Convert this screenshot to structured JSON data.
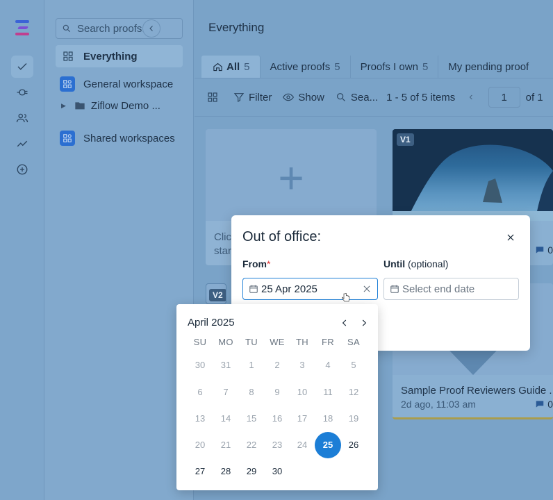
{
  "sidebar": {
    "search_placeholder": "Search proofs...",
    "items": [
      {
        "label": "Everything"
      },
      {
        "label": "General workspace"
      },
      {
        "label": "Ziflow Demo ..."
      },
      {
        "label": "Shared workspaces"
      }
    ]
  },
  "main": {
    "title": "Everything",
    "tabs": [
      {
        "label": "All",
        "count": "5"
      },
      {
        "label": "Active proofs",
        "count": "5"
      },
      {
        "label": "Proofs I own",
        "count": "5"
      },
      {
        "label": "My pending proof",
        "count": ""
      }
    ],
    "toolbar": {
      "filter": "Filter",
      "show": "Show",
      "search": "Sea...",
      "range": "1 - 5 of 5 items",
      "page": "1",
      "of_pages": "of 1"
    },
    "cards": {
      "add_text": "Clic\nstar",
      "card_v1_badge": "V1",
      "card_v1_comments": "0",
      "card_v2_badge": "V2",
      "guide_title": "Sample Proof Reviewers Guide ...",
      "guide_time": "2d ago, 11:03 am",
      "guide_comments": "0"
    }
  },
  "modal": {
    "title": "Out of office:",
    "from_label": "From",
    "required_mark": "*",
    "until_label": "Until",
    "until_hint": "(optional)",
    "from_value": "25 Apr 2025",
    "until_placeholder": "Select end date"
  },
  "calendar": {
    "month_label": "April 2025",
    "weekdays": [
      "SU",
      "MO",
      "TU",
      "WE",
      "TH",
      "FR",
      "SA"
    ],
    "weeks": [
      [
        {
          "d": "30",
          "m": true
        },
        {
          "d": "31",
          "m": true
        },
        {
          "d": "1",
          "m": true
        },
        {
          "d": "2",
          "m": true
        },
        {
          "d": "3",
          "m": true
        },
        {
          "d": "4",
          "m": true
        },
        {
          "d": "5",
          "m": true
        }
      ],
      [
        {
          "d": "6",
          "m": true
        },
        {
          "d": "7",
          "m": true
        },
        {
          "d": "8",
          "m": true
        },
        {
          "d": "9",
          "m": true
        },
        {
          "d": "10",
          "m": true
        },
        {
          "d": "11",
          "m": true
        },
        {
          "d": "12",
          "m": true
        }
      ],
      [
        {
          "d": "13",
          "m": true
        },
        {
          "d": "14",
          "m": true
        },
        {
          "d": "15",
          "m": true
        },
        {
          "d": "16",
          "m": true
        },
        {
          "d": "17",
          "m": true
        },
        {
          "d": "18",
          "m": true
        },
        {
          "d": "19",
          "m": true
        }
      ],
      [
        {
          "d": "20",
          "m": true
        },
        {
          "d": "21",
          "m": true
        },
        {
          "d": "22",
          "m": true
        },
        {
          "d": "23",
          "m": true
        },
        {
          "d": "24",
          "m": true
        },
        {
          "d": "25",
          "selected": true
        },
        {
          "d": "26"
        }
      ],
      [
        {
          "d": "27"
        },
        {
          "d": "28"
        },
        {
          "d": "29"
        },
        {
          "d": "30"
        }
      ]
    ]
  },
  "colors": {
    "accent": "#1c7ed6",
    "required": "#e03131",
    "overlay": "#7aa3c8"
  },
  "icons": {
    "rail": [
      "logo-icon",
      "check-icon",
      "plug-icon",
      "users-icon",
      "trend-icon",
      "plus-circle-icon"
    ]
  }
}
